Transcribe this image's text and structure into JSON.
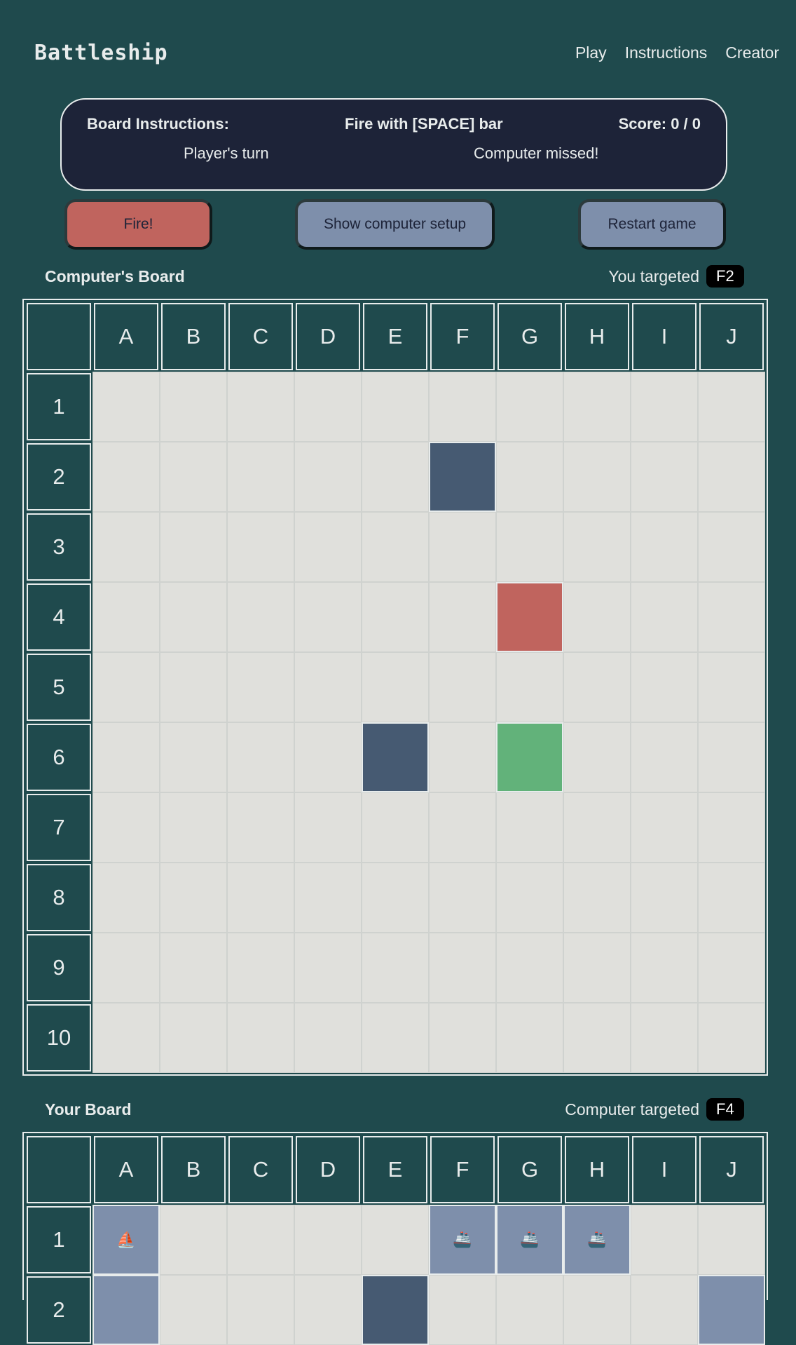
{
  "header": {
    "logo": "Battleship",
    "nav": [
      "Play",
      "Instructions",
      "Creator"
    ]
  },
  "info": {
    "board_instructions": "Board Instructions:",
    "fire_hint": "Fire with [SPACE] bar",
    "score_label": "Score: 0 / 0",
    "turn": "Player's turn",
    "last_event": "Computer missed!"
  },
  "buttons": {
    "fire": "Fire!",
    "show_setup": "Show computer setup",
    "restart": "Restart game"
  },
  "columns": [
    "A",
    "B",
    "C",
    "D",
    "E",
    "F",
    "G",
    "H",
    "I",
    "J"
  ],
  "rows": [
    "1",
    "2",
    "3",
    "4",
    "5",
    "6",
    "7",
    "8",
    "9",
    "10"
  ],
  "computer_board": {
    "title": "Computer's Board",
    "target_label": "You targeted",
    "target": "F2",
    "marks": [
      {
        "cell": "F2",
        "state": "miss"
      },
      {
        "cell": "G4",
        "state": "hit"
      },
      {
        "cell": "E6",
        "state": "miss"
      },
      {
        "cell": "G6",
        "state": "selected"
      }
    ]
  },
  "player_board": {
    "title": "Your Board",
    "target_label": "Computer targeted",
    "target": "F4",
    "marks": [
      {
        "cell": "A1",
        "state": "ship",
        "icon": "⛵"
      },
      {
        "cell": "F1",
        "state": "ship",
        "icon": "🚢"
      },
      {
        "cell": "G1",
        "state": "ship",
        "icon": "🚢"
      },
      {
        "cell": "H1",
        "state": "ship",
        "icon": "🚢"
      },
      {
        "cell": "A2",
        "state": "ship"
      },
      {
        "cell": "E2",
        "state": "miss"
      },
      {
        "cell": "J2",
        "state": "ship"
      }
    ]
  },
  "colors": {
    "background": "#1f4a4d",
    "panel": "#1d2338",
    "hit": "#c0645e",
    "miss": "#465a72",
    "selected": "#62b27a",
    "ship": "#7e8fab",
    "water": "#e0e0dc"
  }
}
